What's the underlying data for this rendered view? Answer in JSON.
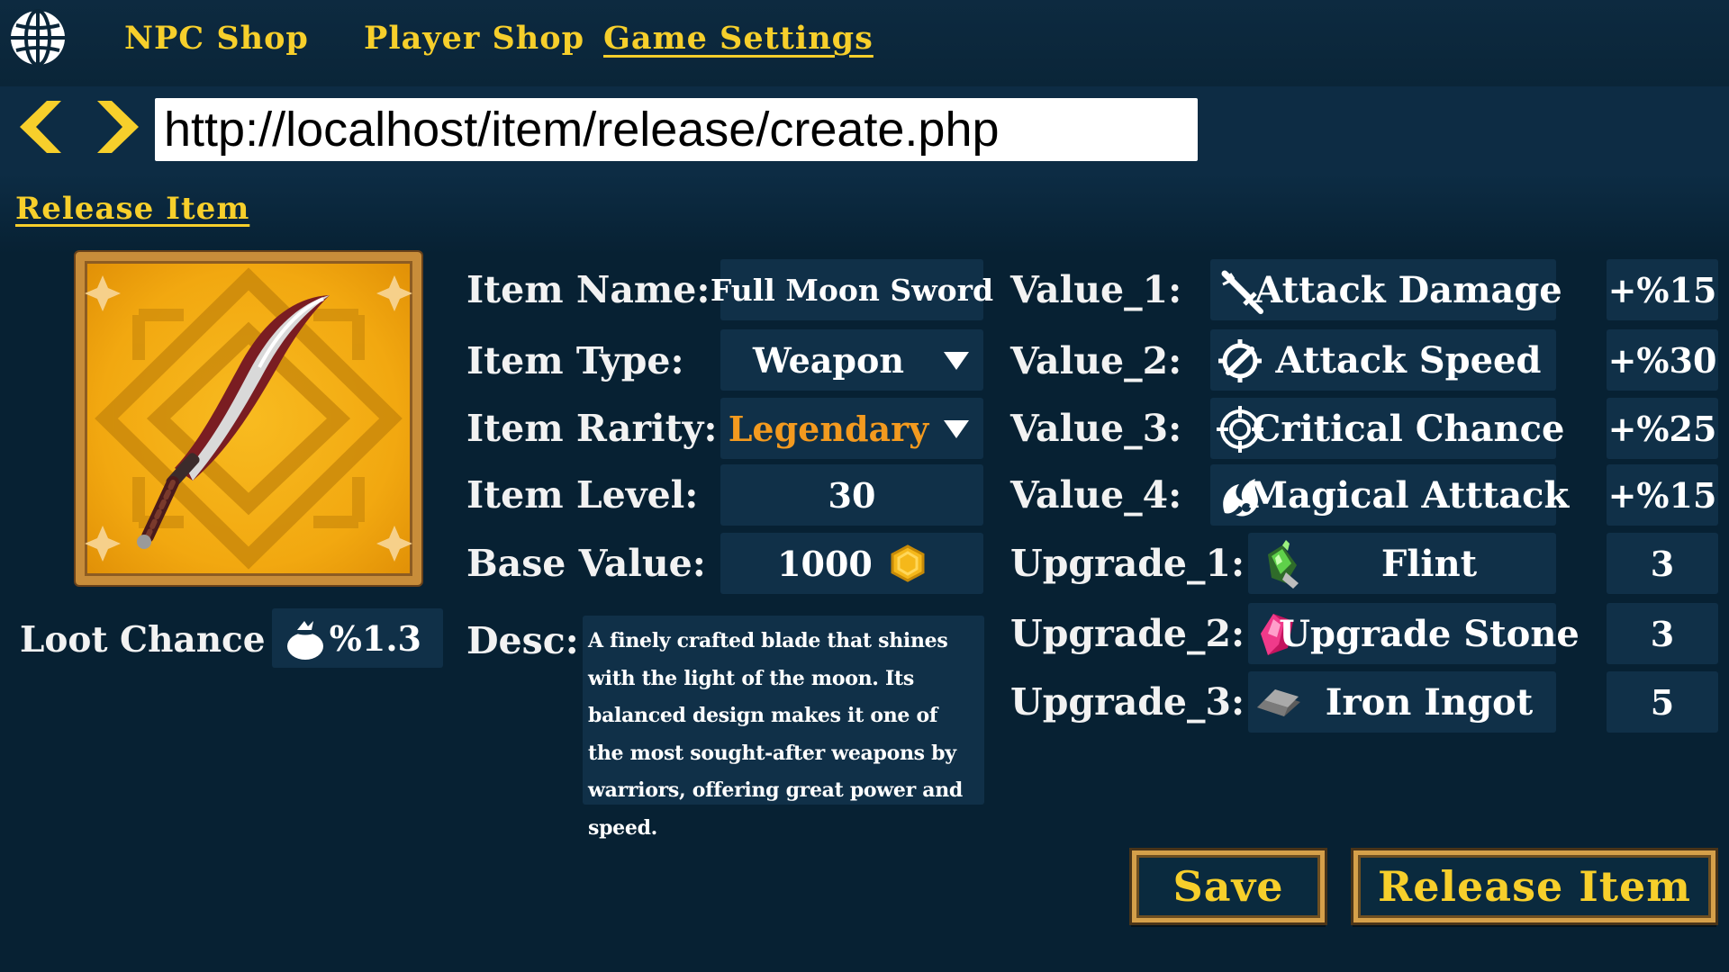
{
  "nav": {
    "items": [
      {
        "label": "NPC Shop"
      },
      {
        "label": "Player Shop"
      },
      {
        "label": "Game Settings"
      }
    ]
  },
  "address_bar": {
    "url": "http://localhost/item/release/create.php"
  },
  "page": {
    "title": "Release Item"
  },
  "item": {
    "name_label": "Item Name:",
    "name": "Full Moon Sword",
    "type_label": "Item Type:",
    "type": "Weapon",
    "rarity_label": "Item Rarity:",
    "rarity": "Legendary",
    "level_label": "Item Level:",
    "level": "30",
    "base_value_label": "Base Value:",
    "base_value": "1000",
    "desc_label": "Desc:",
    "description": "A finely crafted blade that shines with the light of the moon. Its balanced design makes it one of the most sought-after weapons by warriors, offering great power and speed.",
    "loot_label": "Loot Chance",
    "loot_chance": "%1.3"
  },
  "values": [
    {
      "label": "Value_1:",
      "stat": "Attack Damage",
      "amount": "+%15",
      "icon": "sword-icon"
    },
    {
      "label": "Value_2:",
      "stat": "Attack Speed",
      "amount": "+%30",
      "icon": "speed-icon"
    },
    {
      "label": "Value_3:",
      "stat": "Critical Chance",
      "amount": "+%25",
      "icon": "crosshair-icon"
    },
    {
      "label": "Value_4:",
      "stat": "Magical Atttack",
      "amount": "+%15",
      "icon": "magic-icon"
    }
  ],
  "upgrades": [
    {
      "label": "Upgrade_1:",
      "material": "Flint",
      "qty": "3",
      "icon": "flint-icon"
    },
    {
      "label": "Upgrade_2:",
      "material": "Upgrade Stone",
      "qty": "3",
      "icon": "gem-icon"
    },
    {
      "label": "Upgrade_3:",
      "material": "Iron Ingot",
      "qty": "5",
      "icon": "ingot-icon"
    }
  ],
  "buttons": {
    "save": "Save",
    "release": "Release Item"
  },
  "colors": {
    "background": "#072133",
    "accent": "#f7cf2b",
    "field": "#103048",
    "rarity_legendary": "#f39a1f"
  }
}
